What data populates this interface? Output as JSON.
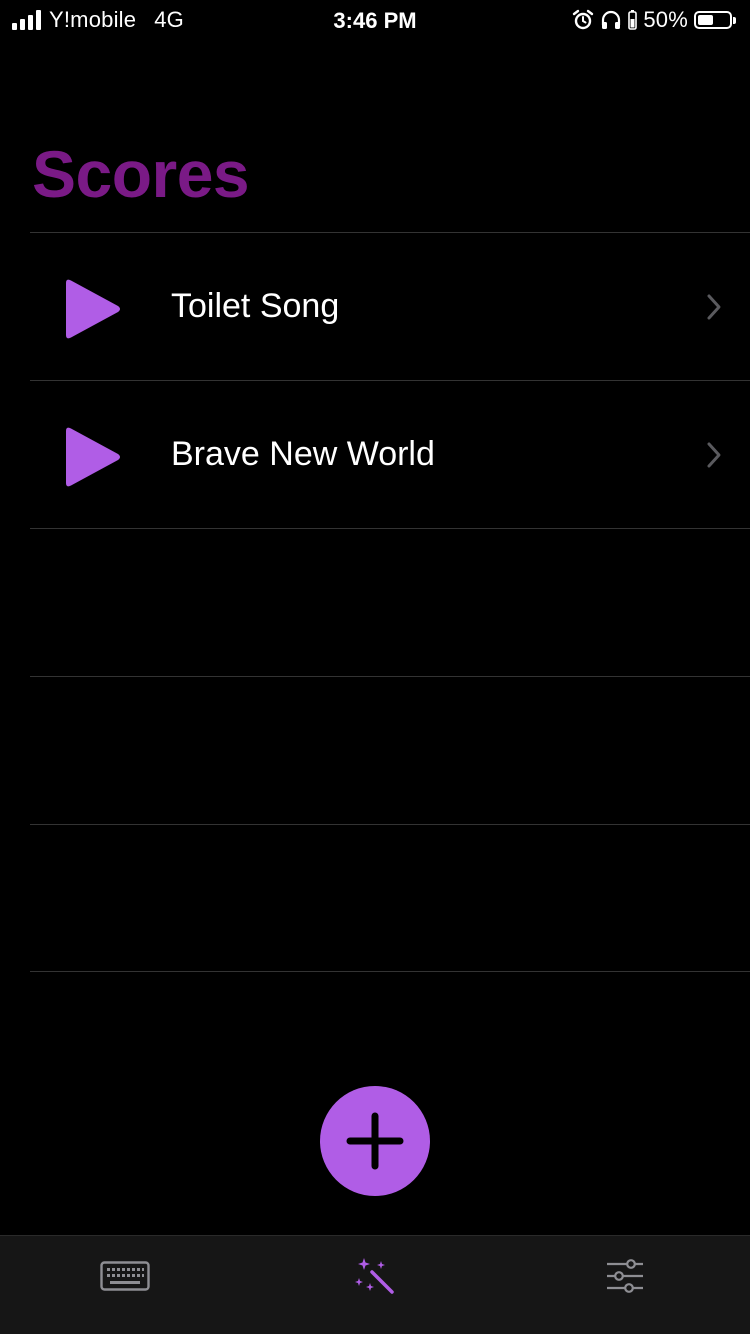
{
  "status_bar": {
    "carrier": "Y!mobile",
    "network": "4G",
    "time": "3:46 PM",
    "battery_percent": "50%",
    "battery_level": 0.5
  },
  "page": {
    "title": "Scores"
  },
  "scores": [
    {
      "name": "Toilet Song"
    },
    {
      "name": "Brave New World"
    }
  ],
  "empty_row_count": 3,
  "tab_bar": {
    "tabs": [
      {
        "icon": "keyboard-icon",
        "active": false
      },
      {
        "icon": "magic-wand-icon",
        "active": true
      },
      {
        "icon": "sliders-icon",
        "active": false
      }
    ]
  },
  "colors": {
    "accent": "#b05de6",
    "title": "#7a1a86",
    "background": "#000000",
    "tab_bar": "#161616"
  }
}
